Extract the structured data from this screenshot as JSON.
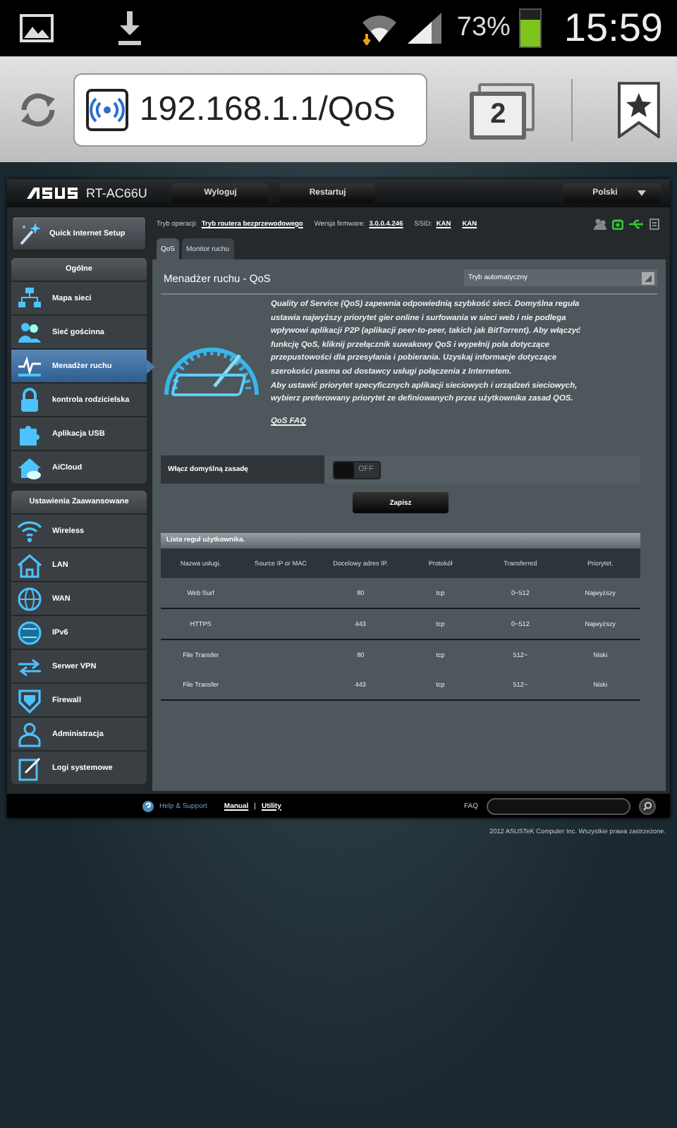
{
  "status_bar": {
    "battery": "73%",
    "time": "15:59"
  },
  "browser": {
    "url": "192.168.1.1/QoS",
    "tab_count": "2"
  },
  "router": {
    "model": "RT-AC66U",
    "buttons": [
      "Wyloguj",
      "Restartuj"
    ],
    "language": "Polski"
  },
  "quick_setup": "Quick Internet Setup",
  "sidebar": {
    "sections": [
      {
        "title": "Ogólne",
        "items": [
          {
            "label": "Mapa sieci",
            "selected": false
          },
          {
            "label": "Sieć gościnna",
            "selected": false
          },
          {
            "label": "Menadżer ruchu",
            "selected": true
          },
          {
            "label": "kontrola rodzicielska",
            "selected": false
          },
          {
            "label": "Aplikacja USB",
            "selected": false
          },
          {
            "label": "AiCloud",
            "selected": false
          }
        ]
      },
      {
        "title": "Ustawienia Zaawansowane",
        "items": [
          {
            "label": "Wireless",
            "selected": false
          },
          {
            "label": "LAN",
            "selected": false
          },
          {
            "label": "WAN",
            "selected": false
          },
          {
            "label": "IPv6",
            "selected": false
          },
          {
            "label": "Serwer VPN",
            "selected": false
          },
          {
            "label": "Firewall",
            "selected": false
          },
          {
            "label": "Administracja",
            "selected": false
          },
          {
            "label": "Logi systemowe",
            "selected": false
          }
        ]
      }
    ]
  },
  "info": {
    "mode_label": "Tryb operacji:",
    "mode": "Tryb routera bezprzewodowego",
    "firmware_label": "Wersja firmware:",
    "firmware": "3.0.0.4.246",
    "ssid_label": "SSID:",
    "ssids": [
      "KAN",
      "KAN"
    ]
  },
  "tabs": [
    {
      "label": "QoS",
      "selected": true
    },
    {
      "label": "Monitor ruchu",
      "selected": false
    }
  ],
  "panel": {
    "title": "Menadżer ruchu - QoS",
    "mode_select": "Tryb automatyczny",
    "description": [
      "Quality of Service (QoS) zapewnia odpowiednią szybkość sieci. Domyślna reguła ustawia najwyższy priorytet gier online i surfowania w sieci web i nie podlega wpływowi aplikacji P2P (aplikacji peer-to-peer, takich jak BitTorrent). Aby włączyć funkcję QoS, kliknij przełącznik suwakowy QoS i wypełnij pola dotyczące przepustowości dla przesyłania i pobierania. Uzyskaj informacje dotyczące szerokości pasma od dostawcy usługi połączenia z Internetem.",
      "Aby ustawić priorytet specyficznych aplikacji sieciowych i urządzeń sieciowych, wybierz preferowany priorytet ze definiowanych przez użytkownika zasad QOS."
    ],
    "faq_link": "QoS FAQ",
    "toggle": {
      "label": "Włącz domyślną zasadę",
      "on": false,
      "state_text": "OFF"
    },
    "save": "Zapisz"
  },
  "rules": {
    "title": "Lista reguł użytkownika.",
    "columns": [
      "Nazwa usługi.",
      "Source IP or MAC",
      "Docelowy adres IP.",
      "Protokół",
      "Transferred",
      "Priorytet."
    ],
    "rows": [
      [
        "Web Surf",
        "",
        "80",
        "tcp",
        "0~512",
        "Najwyższy"
      ],
      [
        "HTTPS",
        "",
        "443",
        "tcp",
        "0~512",
        "Najwyższy"
      ],
      [
        "File Transfer",
        "",
        "80",
        "tcp",
        "512~",
        "Niski"
      ],
      [
        "File Transfer",
        "",
        "443",
        "tcp",
        "512~",
        "Niski"
      ]
    ]
  },
  "footer": {
    "help": "Help & Support",
    "manual": "Manual",
    "separator": "|",
    "utility": "Utility",
    "faq": "FAQ"
  },
  "copyright": "2012 ASUSTeK Computer Inc. Wszystkie prawa zastrzeżone."
}
